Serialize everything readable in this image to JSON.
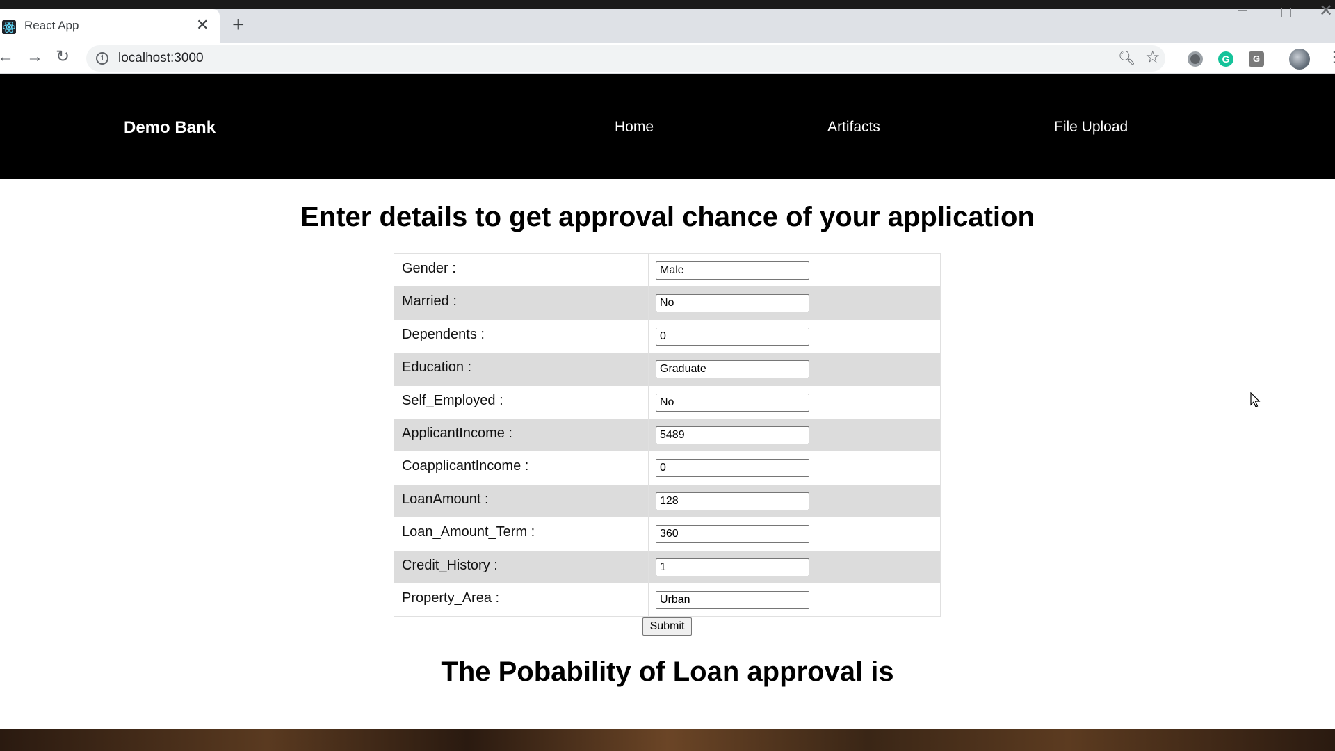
{
  "browser": {
    "tab_title": "React App",
    "url": "localhost:3000"
  },
  "navbar": {
    "brand": "Demo Bank",
    "links": [
      "Home",
      "Artifacts",
      "File Upload"
    ]
  },
  "main": {
    "title": "Enter details to get approval chance of your application",
    "fields": [
      {
        "label": "Gender :",
        "value": "Male"
      },
      {
        "label": "Married :",
        "value": "No"
      },
      {
        "label": "Dependents :",
        "value": "0"
      },
      {
        "label": "Education :",
        "value": "Graduate"
      },
      {
        "label": "Self_Employed :",
        "value": "No"
      },
      {
        "label": "ApplicantIncome :",
        "value": "5489"
      },
      {
        "label": "CoapplicantIncome :",
        "value": "0"
      },
      {
        "label": "LoanAmount :",
        "value": "128"
      },
      {
        "label": "Loan_Amount_Term :",
        "value": "360"
      },
      {
        "label": "Credit_History :",
        "value": "1"
      },
      {
        "label": "Property_Area :",
        "value": "Urban"
      }
    ],
    "submit_label": "Submit",
    "result_text": "The Pobability of Loan approval is"
  }
}
